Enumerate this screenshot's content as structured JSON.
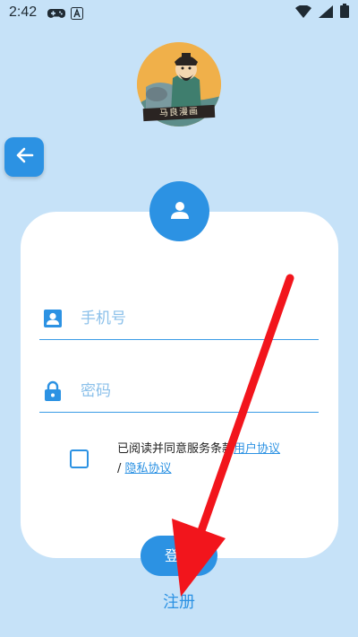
{
  "status_bar": {
    "time": "2:42",
    "icons": [
      "gamepad-icon",
      "font-a-icon",
      "wifi-icon",
      "signal-icon",
      "battery-icon"
    ]
  },
  "logo": {
    "plate_text": "马良漫画"
  },
  "back_button": {
    "icon": "arrow-left-icon"
  },
  "login_form": {
    "phone_placeholder": "手机号",
    "password_placeholder": "密码",
    "agreement_prefix": "已阅读并同意服务条款",
    "user_agreement_link": "用户协议",
    "separator": "/",
    "privacy_link": "隐私协议",
    "login_button": "登录",
    "register_link": "注册"
  },
  "colors": {
    "background": "#c6e2f8",
    "accent": "#2c92e3",
    "card": "#ffffff",
    "annotation_arrow": "#f2151c"
  }
}
